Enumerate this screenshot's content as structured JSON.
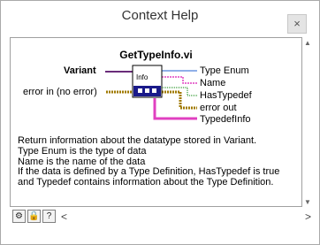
{
  "window": {
    "title": "Context Help",
    "close_glyph": "×"
  },
  "help": {
    "vi_name": "GetTypeInfo.vi",
    "inputs": [
      {
        "label": "Variant",
        "bold": true
      },
      {
        "label": "error in (no error)",
        "bold": false
      }
    ],
    "outputs": [
      "Type Enum",
      "Name",
      "HasTypedef",
      "error out",
      "TypedefInfo"
    ],
    "icon_text": "Info",
    "description": [
      "Return information about the datatype stored in Variant.",
      "Type Enum is the type of data",
      "Name is the name of the data",
      "If the data is defined by a Type Definition, HasTypedef is true and Typedef contains information about the Type Definition."
    ]
  },
  "toolbar": {
    "buttons": [
      {
        "name": "detailed-help-icon",
        "glyph": "⚙"
      },
      {
        "name": "lock-icon",
        "glyph": "🔒"
      },
      {
        "name": "question-icon",
        "glyph": "?"
      }
    ]
  },
  "scroll": {
    "left_glyph": "<",
    "right_glyph": ">",
    "up_glyph": "▲",
    "down_glyph": "▼"
  },
  "colors": {
    "variant_wire": "#6a2c7a",
    "error_wire": "#a07a00",
    "string_wire": "#e040c0",
    "enum_wire": "#2060d0",
    "bool_wire": "#008000"
  }
}
